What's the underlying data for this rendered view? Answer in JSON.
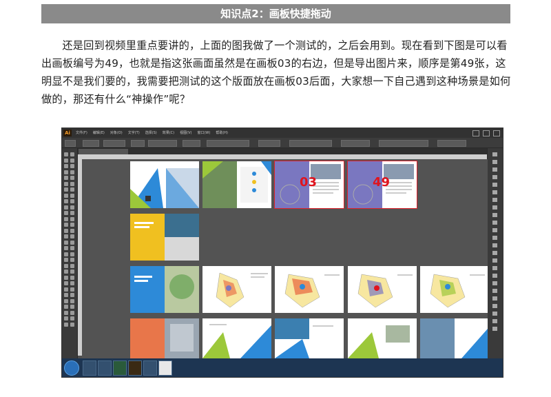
{
  "banner": {
    "title": "知识点2：画板快捷拖动"
  },
  "paragraph": "还是回到视频里重点要讲的，上面的图我做了一个测试的，之后会用到。现在看到下图是可以看出画板编号为49，也就是指这张画面虽然是在画板03的右边，但是导出图片来，顺序是第49张，这明显不是我们要的，我需要把测试的这个版面放在画板03后面，大家想一下自己遇到这种场景是如何做的，那还有什么“神操作”呢？",
  "screenshot": {
    "app_logo": "Ai",
    "menu_items": [
      "文件(F)",
      "编辑(E)",
      "对象(O)",
      "文字(T)",
      "选择(S)",
      "效果(C)",
      "视图(V)",
      "窗口(W)",
      "帮助(H)"
    ],
    "artboard_labels": {
      "first": "03",
      "second": "49"
    },
    "colors": {
      "accent_red": "#e0141e",
      "canvas": "#535353",
      "blue": "#2d8ad8",
      "yellow": "#f0c020",
      "green": "#9cc83a",
      "orange": "#e8764a",
      "purple": "#7a77c0"
    }
  }
}
